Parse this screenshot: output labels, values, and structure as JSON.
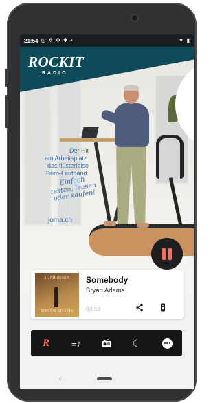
{
  "status_bar": {
    "time": "21:54",
    "left_icons": [
      "whatsapp-icon",
      "settings-cog-icon",
      "fan-icon",
      "bluetooth-icon",
      "dot-icon"
    ],
    "right_icons": [
      "wifi-icon",
      "battery-icon"
    ]
  },
  "logo": {
    "main": "ROCKIT",
    "sub": "RADIO"
  },
  "ad": {
    "lines": [
      "Der Hit",
      "am Arbeitsplatz:",
      "das flüsterleise",
      "Büro-Laufband."
    ],
    "script_lines": [
      "Einfach",
      "testen, leasen",
      "oder kaufen!"
    ],
    "url": "joma.ch"
  },
  "player": {
    "state": "playing",
    "song_title": "Somebody",
    "artist": "Bryan Adams",
    "elapsed": "03:59",
    "album_cover_title": "SOMEBODY",
    "album_cover_artist": "BRYAN ADAMS",
    "accent_color": "#ff6b5a"
  },
  "bottom_nav": {
    "items": [
      {
        "name": "rockit-home",
        "icon": "rockit-logo-icon",
        "active": true
      },
      {
        "name": "playlist",
        "icon": "music-list-icon",
        "active": false
      },
      {
        "name": "radio",
        "icon": "radio-icon",
        "active": false
      },
      {
        "name": "sleep-timer",
        "icon": "moon-icon",
        "active": false
      },
      {
        "name": "more",
        "icon": "more-dots-icon",
        "active": false
      }
    ]
  }
}
